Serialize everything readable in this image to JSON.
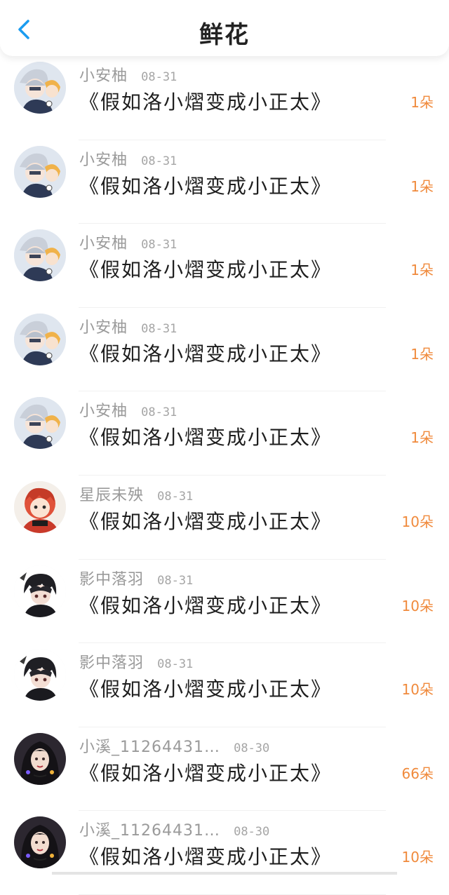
{
  "header": {
    "title": "鲜花"
  },
  "colors": {
    "accent": "#1a9cf0",
    "amount": "#f08a3c",
    "meta": "#9a9a9a"
  },
  "records": [
    {
      "user": "小安柚",
      "date": "08-31",
      "book": "《假如洛小熠变成小正太》",
      "amount": "1朵",
      "avatar": "silver-hair-duo"
    },
    {
      "user": "小安柚",
      "date": "08-31",
      "book": "《假如洛小熠变成小正太》",
      "amount": "1朵",
      "avatar": "silver-hair-duo"
    },
    {
      "user": "小安柚",
      "date": "08-31",
      "book": "《假如洛小熠变成小正太》",
      "amount": "1朵",
      "avatar": "silver-hair-duo"
    },
    {
      "user": "小安柚",
      "date": "08-31",
      "book": "《假如洛小熠变成小正太》",
      "amount": "1朵",
      "avatar": "silver-hair-duo"
    },
    {
      "user": "小安柚",
      "date": "08-31",
      "book": "《假如洛小熠变成小正太》",
      "amount": "1朵",
      "avatar": "silver-hair-duo"
    },
    {
      "user": "星辰未殃",
      "date": "08-31",
      "book": "《假如洛小熠变成小正太》",
      "amount": "10朵",
      "avatar": "red-hair-chibi"
    },
    {
      "user": "影中落羽",
      "date": "08-31",
      "book": "《假如洛小熠变成小正太》",
      "amount": "10朵",
      "avatar": "dark-hair-boy"
    },
    {
      "user": "影中落羽",
      "date": "08-31",
      "book": "《假如洛小熠变成小正太》",
      "amount": "10朵",
      "avatar": "dark-hair-boy"
    },
    {
      "user": "小溪_11264431…",
      "date": "08-30",
      "book": "《假如洛小熠变成小正太》",
      "amount": "66朵",
      "avatar": "dark-hair-girl"
    },
    {
      "user": "小溪_11264431…",
      "date": "08-30",
      "book": "《假如洛小熠变成小正太》",
      "amount": "10朵",
      "avatar": "dark-hair-girl"
    }
  ]
}
